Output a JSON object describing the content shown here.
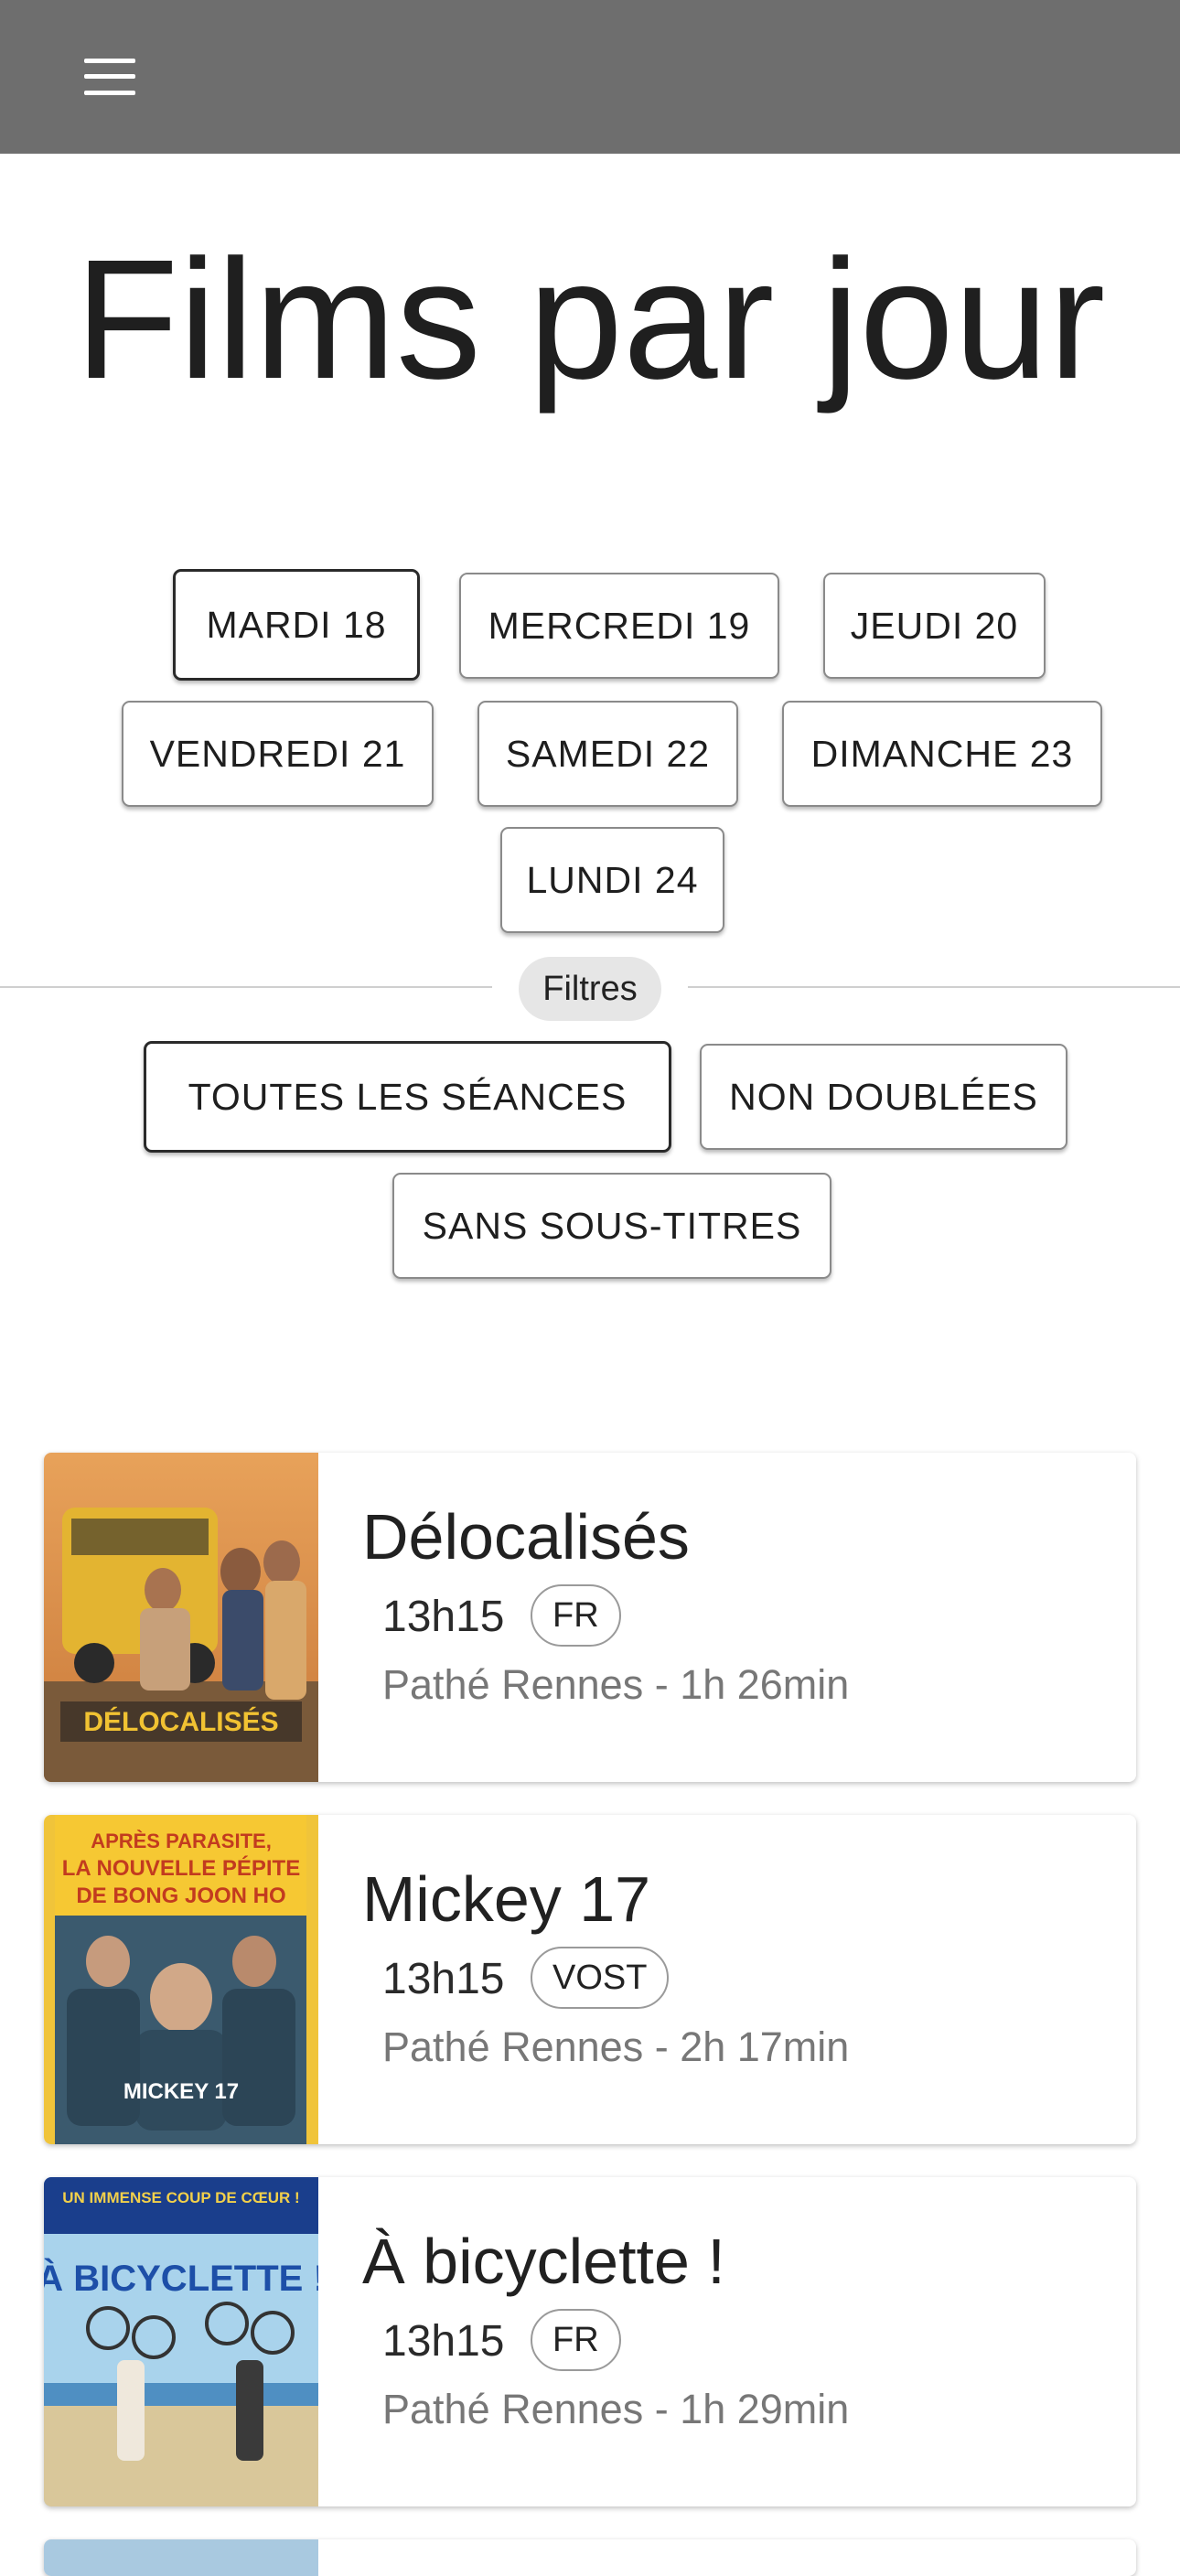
{
  "header": {
    "menu_icon": "hamburger-menu-icon",
    "background": "#6e6e6e"
  },
  "page": {
    "title": "Films par jour"
  },
  "days": [
    {
      "label": "MARDI 18",
      "selected": true
    },
    {
      "label": "MERCREDI 19",
      "selected": false
    },
    {
      "label": "JEUDI 20",
      "selected": false
    },
    {
      "label": "VENDREDI 21",
      "selected": false
    },
    {
      "label": "SAMEDI 22",
      "selected": false
    },
    {
      "label": "DIMANCHE 23",
      "selected": false
    },
    {
      "label": "LUNDI 24",
      "selected": false
    }
  ],
  "filters": {
    "section_label": "Filtres",
    "options": [
      {
        "label": "TOUTES LES SÉANCES",
        "selected": true
      },
      {
        "label": "NON DOUBLÉES",
        "selected": false
      },
      {
        "label": "SANS SOUS-TITRES",
        "selected": false
      }
    ]
  },
  "films": [
    {
      "title": "Délocalisés",
      "time": "13h15",
      "language": "FR",
      "meta": "Pathé Rennes - 1h 26min",
      "poster_text": "DÉLOCALISÉS"
    },
    {
      "title": "Mickey 17",
      "time": "13h15",
      "language": "VOST",
      "meta": "Pathé Rennes - 2h 17min",
      "poster_text": "APRÈS PARASITE, LA NOUVELLE PÉPITE DE BONG JOON HO"
    },
    {
      "title": "À bicyclette !",
      "time": "13h15",
      "language": "FR",
      "meta": "Pathé Rennes - 1h 29min",
      "poster_text": "À BICYCLETTE !"
    }
  ]
}
